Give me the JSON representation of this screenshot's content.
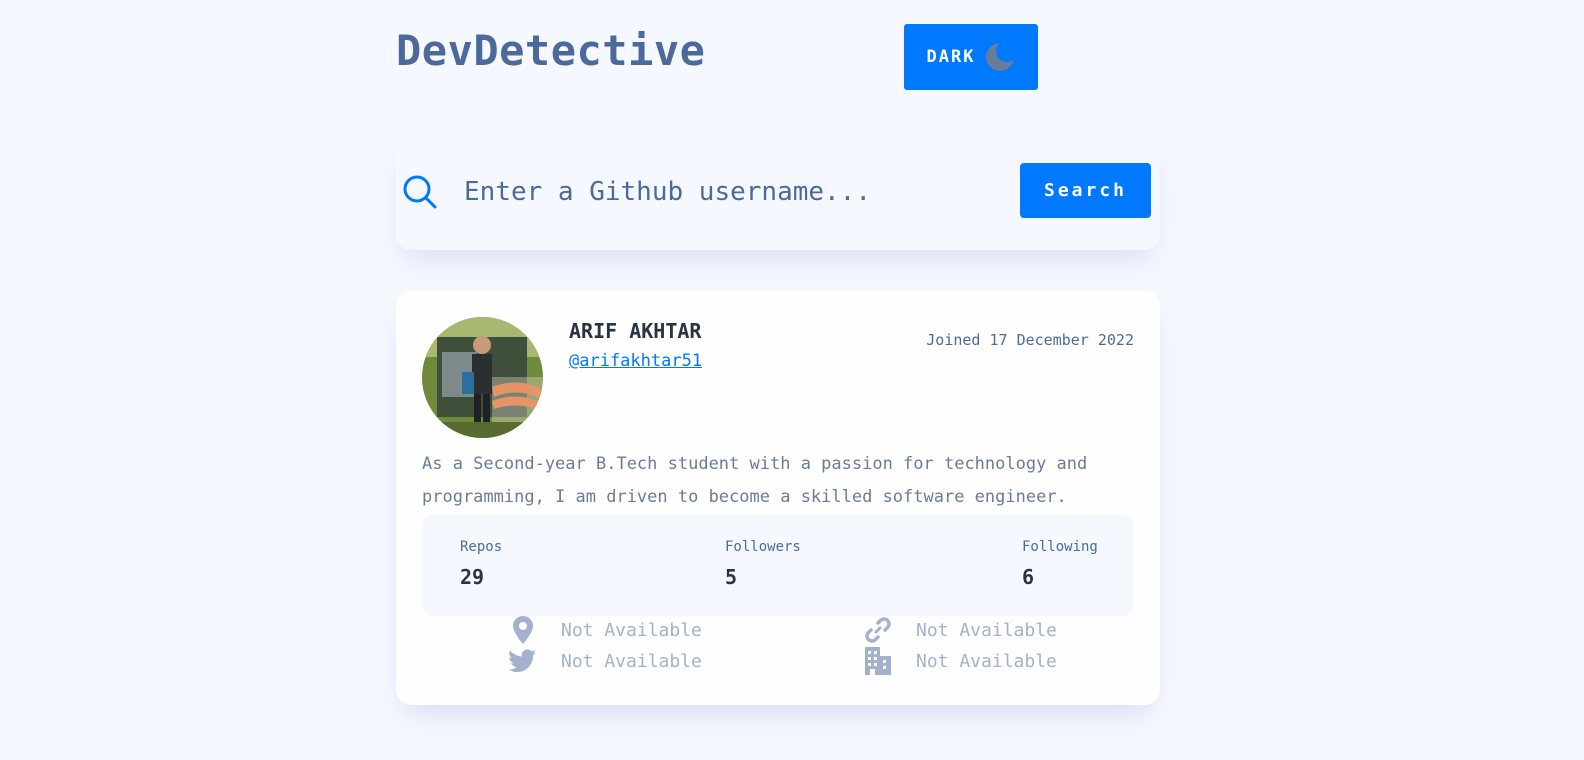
{
  "header": {
    "title": "DevDetective",
    "mode_label": "DARK",
    "mode_icon": "moon-icon"
  },
  "search": {
    "placeholder": "Enter a Github username...",
    "button_label": "Search",
    "icon": "search-icon"
  },
  "profile": {
    "name": "ARIF AKHTAR",
    "handle": "@arifakhtar51",
    "joined": "Joined 17 December 2022",
    "bio": "As a Second-year B.Tech student with a passion for technology and programming, I am driven to become a skilled software engineer.",
    "stats": {
      "repos_label": "Repos",
      "repos_value": "29",
      "followers_label": "Followers",
      "followers_value": "5",
      "following_label": "Following",
      "following_value": "6"
    },
    "links": {
      "location": "Not Available",
      "website": "Not Available",
      "twitter": "Not Available",
      "company": "Not Available"
    }
  },
  "colors": {
    "accent": "#0079ff",
    "background": "#f6f8ff",
    "title": "#4b6a9b",
    "muted": "#a3b1cc"
  }
}
